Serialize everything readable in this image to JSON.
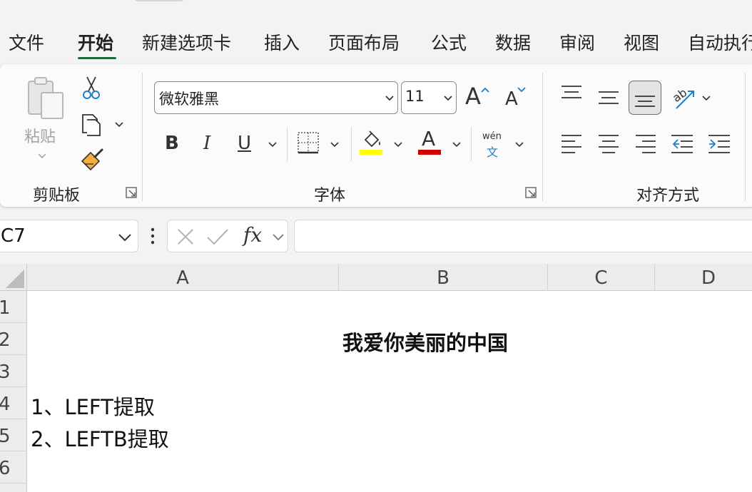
{
  "menu": {
    "tabs": [
      "文件",
      "开始",
      "新建选项卡",
      "插入",
      "页面布局",
      "公式",
      "数据",
      "审阅",
      "视图",
      "自动执行"
    ],
    "active_index": 1
  },
  "ribbon": {
    "clipboard": {
      "paste_label": "粘贴",
      "group_label": "剪贴板"
    },
    "font": {
      "font_name": "微软雅黑",
      "font_size": "11",
      "grow_label": "A",
      "shrink_label": "A",
      "bold_label": "B",
      "italic_label": "I",
      "underline_label": "U",
      "phonetic_top": "wén",
      "phonetic_bottom": "文",
      "highlight_color": "#ffff00",
      "font_color": "#d00000",
      "group_label": "字体"
    },
    "alignment": {
      "group_label": "对齐方式",
      "active_button": "bottom-align"
    }
  },
  "formula_bar": {
    "name_box": "C7",
    "fx_label": "fx",
    "formula": ""
  },
  "grid": {
    "columns": [
      "A",
      "B",
      "C",
      "D"
    ],
    "rows": [
      "1",
      "2",
      "3",
      "4",
      "5",
      "6"
    ],
    "cells": {
      "title": "我爱你美丽的中国",
      "a4": "1、LEFT提取",
      "a5": "2、LEFTB提取"
    }
  },
  "colors": {
    "accent": "#1e6b3a"
  }
}
